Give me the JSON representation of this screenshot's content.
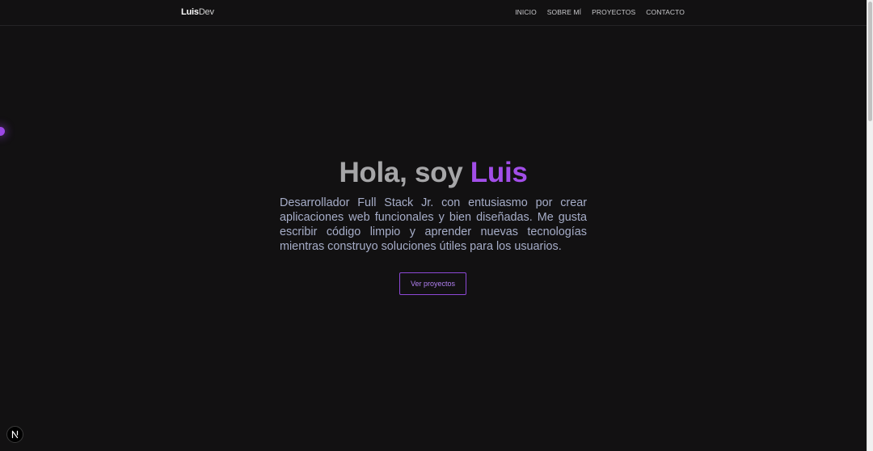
{
  "navbar": {
    "logo": {
      "bold": "Luis",
      "light": "Dev"
    },
    "links": [
      {
        "label": "INICIO"
      },
      {
        "label": "SOBRE MÍ"
      },
      {
        "label": "PROYECTOS"
      },
      {
        "label": "CONTACTO"
      }
    ]
  },
  "hero": {
    "title_prefix": "Hola, soy ",
    "title_name": "Luis",
    "description": "Desarrollador Full Stack Jr. con entusiasmo por crear aplicaciones web funcionales y bien diseñadas. Me gusta escribir código limpio y aprender nuevas tecnologías mientras construyo soluciones útiles para los usuarios.",
    "cta_label": "Ver proyectos"
  },
  "badge": {
    "icon": "nextjs-n-icon",
    "letter": "N"
  },
  "colors": {
    "background": "#121112",
    "accent": "#a24ee8",
    "title_gray": "#a6a6a8",
    "text_muted": "#a6adc8"
  }
}
